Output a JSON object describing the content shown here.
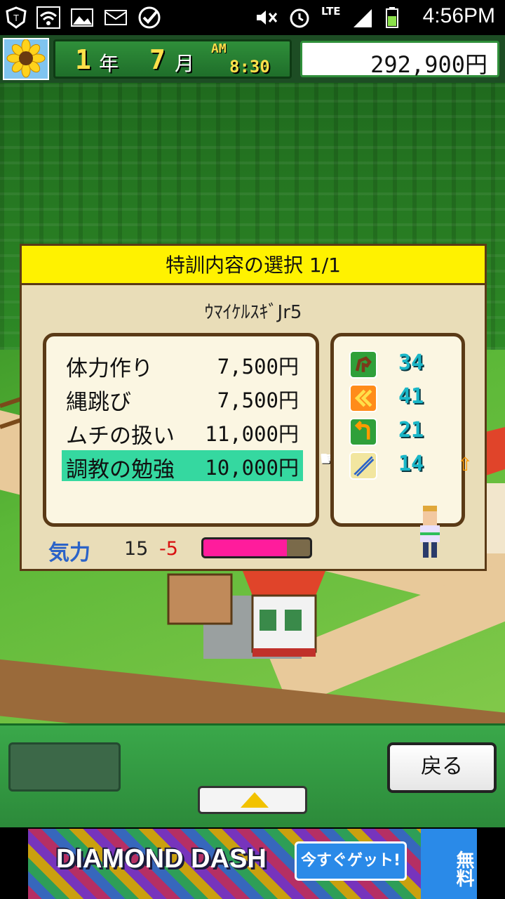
{
  "status_bar": {
    "time": "4:56PM",
    "network": "LTE",
    "icons": [
      "shield-icon",
      "wifi-icon",
      "image-icon",
      "mail-icon",
      "check-icon",
      "mute-icon",
      "alarm-icon",
      "signal-icon",
      "battery-icon"
    ]
  },
  "top_bar": {
    "year": "1",
    "year_unit": "年",
    "month": "7",
    "month_unit": "月",
    "ampm": "AM",
    "time": "8:30",
    "money": "292,900円"
  },
  "dialog": {
    "title": "特訓内容の選択 1/1",
    "horse_name": "ｳﾏｲｹﾙｽｷﾞJr5",
    "items": [
      {
        "name": "体力作り",
        "price": "7,500円"
      },
      {
        "name": "縄跳び",
        "price": "7,500円"
      },
      {
        "name": "ムチの扱い",
        "price": "11,000円"
      },
      {
        "name": "調教の勉強",
        "price": "10,000円"
      }
    ],
    "stats": [
      {
        "icon": "horse-stamina-icon",
        "value": "34"
      },
      {
        "icon": "speed-chevron-icon",
        "value": "41"
      },
      {
        "icon": "turn-arrow-icon",
        "value": "21"
      },
      {
        "icon": "whip-icon",
        "value": "14"
      }
    ],
    "energy_label": "気力",
    "energy_value": "15",
    "energy_delta": "-5",
    "energy_fraction": 0.78
  },
  "controls": {
    "back_label": "戻る"
  },
  "ad": {
    "title": "DIAMOND DASH",
    "cta": "今すぐゲット!",
    "badge": "無料"
  },
  "colors": {
    "selected_row": "#35d8a0",
    "title_bar": "#fff200",
    "energy_fill": "#ff1c9c"
  }
}
